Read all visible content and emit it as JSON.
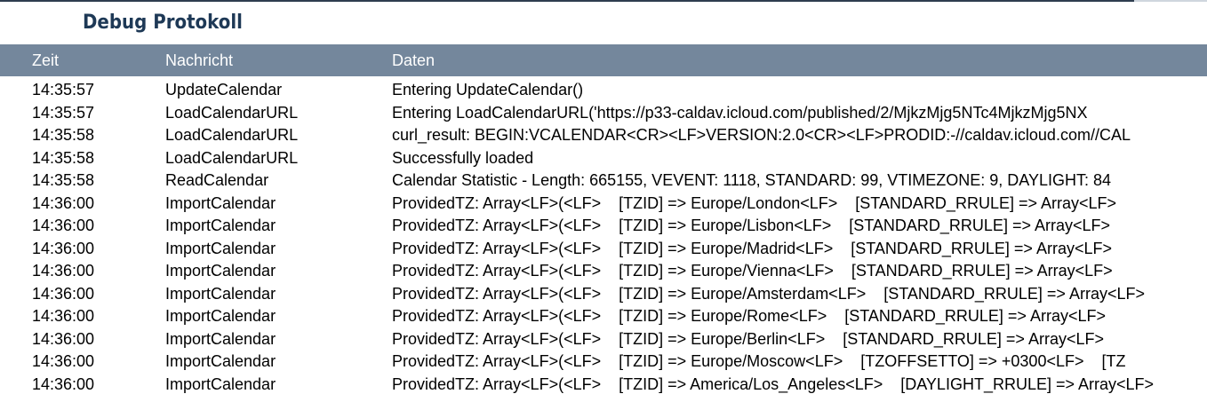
{
  "page": {
    "title": "Debug Protokoll"
  },
  "table": {
    "columns": {
      "time": "Zeit",
      "message": "Nachricht",
      "data": "Daten"
    },
    "rows": [
      {
        "time": "14:35:57",
        "message": "UpdateCalendar",
        "data": "Entering UpdateCalendar()"
      },
      {
        "time": "14:35:57",
        "message": "LoadCalendarURL",
        "data": "Entering LoadCalendarURL('https://p33-caldav.icloud.com/published/2/MjkzMjg5NTc4MjkzMjg5NX"
      },
      {
        "time": "14:35:58",
        "message": "LoadCalendarURL",
        "data": "curl_result: BEGIN:VCALENDAR<CR><LF>VERSION:2.0<CR><LF>PRODID:-//caldav.icloud.com//CAL"
      },
      {
        "time": "14:35:58",
        "message": "LoadCalendarURL",
        "data": "Successfully loaded"
      },
      {
        "time": "14:35:58",
        "message": "ReadCalendar",
        "data": "Calendar Statistic - Length: 665155, VEVENT: 1118, STANDARD: 99, VTIMEZONE: 9, DAYLIGHT: 84"
      },
      {
        "time": "14:36:00",
        "message": "ImportCalendar",
        "data": "ProvidedTZ: Array<LF>(<LF>    [TZID] => Europe/London<LF>    [STANDARD_RRULE] => Array<LF>"
      },
      {
        "time": "14:36:00",
        "message": "ImportCalendar",
        "data": "ProvidedTZ: Array<LF>(<LF>    [TZID] => Europe/Lisbon<LF>    [STANDARD_RRULE] => Array<LF>"
      },
      {
        "time": "14:36:00",
        "message": "ImportCalendar",
        "data": "ProvidedTZ: Array<LF>(<LF>    [TZID] => Europe/Madrid<LF>    [STANDARD_RRULE] => Array<LF>"
      },
      {
        "time": "14:36:00",
        "message": "ImportCalendar",
        "data": "ProvidedTZ: Array<LF>(<LF>    [TZID] => Europe/Vienna<LF>    [STANDARD_RRULE] => Array<LF>"
      },
      {
        "time": "14:36:00",
        "message": "ImportCalendar",
        "data": "ProvidedTZ: Array<LF>(<LF>    [TZID] => Europe/Amsterdam<LF>    [STANDARD_RRULE] => Array<LF>"
      },
      {
        "time": "14:36:00",
        "message": "ImportCalendar",
        "data": "ProvidedTZ: Array<LF>(<LF>    [TZID] => Europe/Rome<LF>    [STANDARD_RRULE] => Array<LF>"
      },
      {
        "time": "14:36:00",
        "message": "ImportCalendar",
        "data": "ProvidedTZ: Array<LF>(<LF>    [TZID] => Europe/Berlin<LF>    [STANDARD_RRULE] => Array<LF>"
      },
      {
        "time": "14:36:00",
        "message": "ImportCalendar",
        "data": "ProvidedTZ: Array<LF>(<LF>    [TZID] => Europe/Moscow<LF>    [TZOFFSETTO] => +0300<LF>    [TZ"
      },
      {
        "time": "14:36:00",
        "message": "ImportCalendar",
        "data": "ProvidedTZ: Array<LF>(<LF>    [TZID] => America/Los_Angeles<LF>    [DAYLIGHT_RRULE] => Array<LF>"
      }
    ]
  }
}
